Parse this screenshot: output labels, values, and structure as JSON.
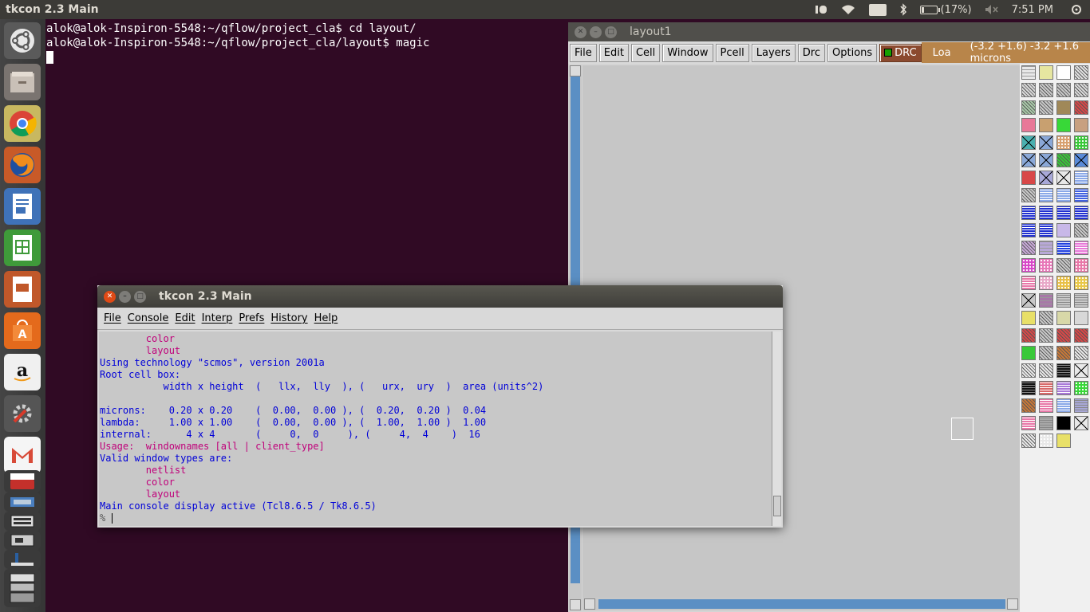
{
  "topbar": {
    "title": "tkcon 2.3 Main",
    "lang": "En",
    "battery": "(17%)",
    "battery_level": 0.17,
    "time": "7:51 PM"
  },
  "launcher": {
    "icons": [
      "ubuntu-dash-icon",
      "files-icon",
      "chrome-icon",
      "firefox-icon",
      "writer-icon",
      "calc-icon",
      "impress-icon",
      "software-center-icon",
      "amazon-icon",
      "settings-icon",
      "gmail-icon",
      "youtube-icon",
      "app-icon-1",
      "app-icon-2",
      "app-icon-3",
      "app-icon-4",
      "app-icon-5"
    ]
  },
  "terminal": {
    "lines": [
      "alok@alok-Inspiron-5548:~/qflow/project_cla$ cd layout/",
      "alok@alok-Inspiron-5548:~/qflow/project_cla/layout$ magic"
    ]
  },
  "layoutwin": {
    "title": "layout1",
    "menu": [
      "File",
      "Edit",
      "Cell",
      "Window",
      "Pcell",
      "Layers",
      "Drc",
      "Options"
    ],
    "drc": "DRC",
    "loa": "Loa",
    "coords": "(-3.2 +1.6) -3.2 +1.6 microns"
  },
  "tkcon": {
    "title": "tkcon 2.3 Main",
    "menu": [
      "File",
      "Console",
      "Edit",
      "Interp",
      "Prefs",
      "History",
      "Help"
    ],
    "lines": [
      {
        "cls": "red",
        "text": "        color"
      },
      {
        "cls": "red",
        "text": "        layout"
      },
      {
        "cls": "blue",
        "text": "Using technology \"scmos\", version 2001a"
      },
      {
        "cls": "blue",
        "text": "Root cell box:"
      },
      {
        "cls": "blue",
        "text": "           width x height  (   llx,  lly  ), (   urx,  ury  )  area (units^2)"
      },
      {
        "cls": "blue",
        "text": ""
      },
      {
        "cls": "blue",
        "text": "microns:    0.20 x 0.20    (  0.00,  0.00 ), (  0.20,  0.20 )  0.04"
      },
      {
        "cls": "blue",
        "text": "lambda:     1.00 x 1.00    (  0.00,  0.00 ), (  1.00,  1.00 )  1.00"
      },
      {
        "cls": "blue",
        "text": "internal:      4 x 4       (     0,  0     ), (     4,  4    )  16"
      },
      {
        "cls": "red",
        "text": "Usage:  windownames [all | client_type]"
      },
      {
        "cls": "blue",
        "text": "Valid window types are:"
      },
      {
        "cls": "red",
        "text": "        netlist"
      },
      {
        "cls": "red",
        "text": "        color"
      },
      {
        "cls": "red",
        "text": "        layout"
      },
      {
        "cls": "blue",
        "text": "Main console display active (Tcl8.6.5 / Tk8.6.5)"
      }
    ],
    "prompt": "%"
  },
  "colors": {
    "terminal_bg": "#300a24",
    "console_blue": "#0000d8",
    "console_red": "#c0007a",
    "scroll_thumb": "#5b8fc4",
    "drc_bg": "#8b4a2f",
    "coord_bg": "#b8854a"
  }
}
